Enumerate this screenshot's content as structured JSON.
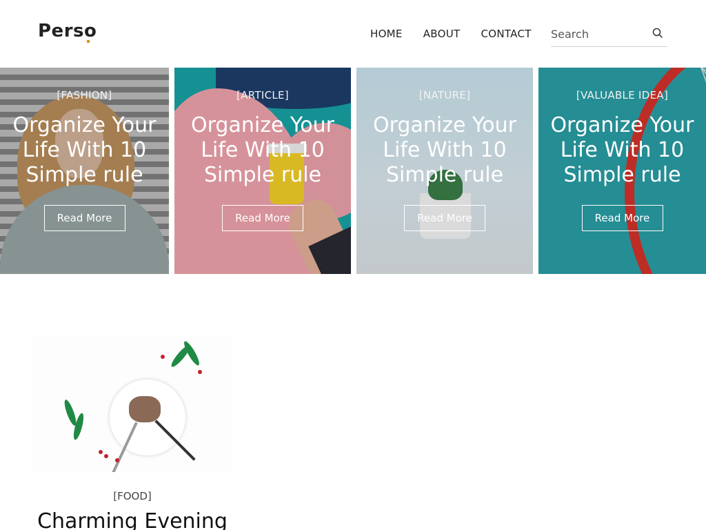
{
  "header": {
    "logo": "Perso",
    "nav": [
      {
        "label": "HOME"
      },
      {
        "label": "ABOUT"
      },
      {
        "label": "CONTACT"
      }
    ],
    "search": {
      "placeholder": "Search"
    }
  },
  "slider": {
    "cards": [
      {
        "tag": "[FASHION]",
        "title": "Organize Your Life With 10 Simple rule",
        "button": "Read More"
      },
      {
        "tag": "[ARTICLE]",
        "title": "Organize Your Life With 10 Simple rule",
        "button": "Read More"
      },
      {
        "tag": "[NATURE]",
        "title": "Organize Your Life With 10 Simple rule",
        "button": "Read More"
      },
      {
        "tag": "[VALUABLE IDEA]",
        "title": "Organize Your Life With 10 Simple rule",
        "button": "Read More"
      }
    ]
  },
  "posts": [
    {
      "tag": "[FOOD]",
      "title": "Charming Evening"
    }
  ],
  "colors": {
    "accent": "#e08a1e",
    "text": "#222222"
  }
}
